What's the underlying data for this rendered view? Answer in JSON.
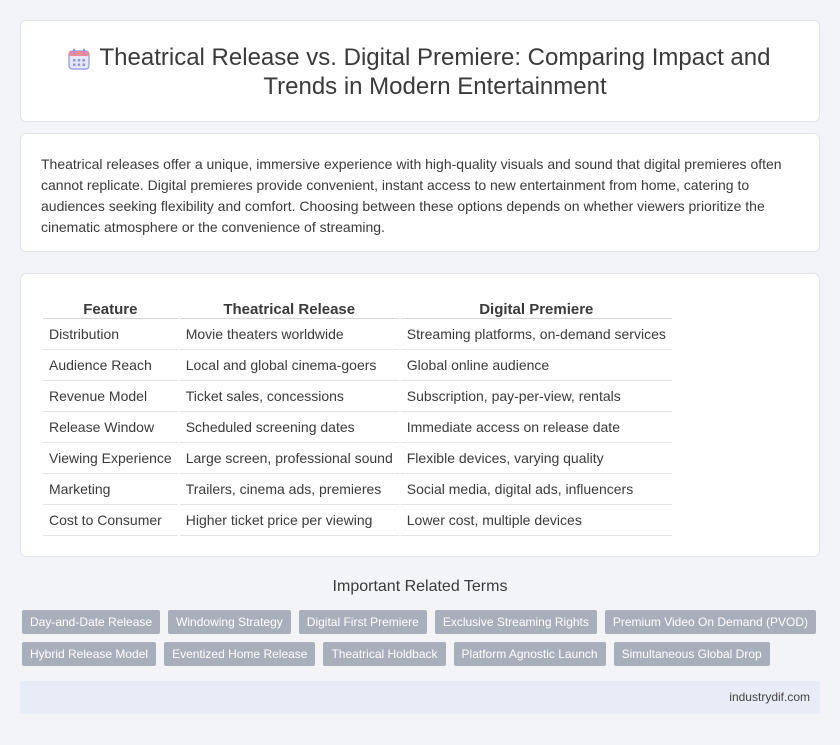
{
  "header": {
    "title": "Theatrical Release vs. Digital Premiere: Comparing Impact and Trends in Modern Entertainment",
    "icon": "calendar-icon",
    "icon_color": "#7b82d6"
  },
  "intro": {
    "text": "Theatrical releases offer a unique, immersive experience with high-quality visuals and sound that digital premieres often cannot replicate. Digital premieres provide convenient, instant access to new entertainment from home, catering to audiences seeking flexibility and comfort. Choosing between these options depends on whether viewers prioritize the cinematic atmosphere or the convenience of streaming."
  },
  "comparison": {
    "headers": [
      "Feature",
      "Theatrical Release",
      "Digital Premiere"
    ],
    "rows": [
      [
        "Distribution",
        "Movie theaters worldwide",
        "Streaming platforms, on-demand services"
      ],
      [
        "Audience Reach",
        "Local and global cinema-goers",
        "Global online audience"
      ],
      [
        "Revenue Model",
        "Ticket sales, concessions",
        "Subscription, pay-per-view, rentals"
      ],
      [
        "Release Window",
        "Scheduled screening dates",
        "Immediate access on release date"
      ],
      [
        "Viewing Experience",
        "Large screen, professional sound",
        "Flexible devices, varying quality"
      ],
      [
        "Marketing",
        "Trailers, cinema ads, premieres",
        "Social media, digital ads, influencers"
      ],
      [
        "Cost to Consumer",
        "Higher ticket price per viewing",
        "Lower cost, multiple devices"
      ]
    ]
  },
  "related": {
    "heading": "Important Related Terms",
    "rows": [
      [
        "Day-and-Date Release",
        "Windowing Strategy",
        "Digital First Premiere",
        "Exclusive Streaming Rights",
        "Premium Video On Demand (PVOD)"
      ],
      [
        "Hybrid Release Model",
        "Eventized Home Release",
        "Theatrical Holdback",
        "Platform Agnostic Launch",
        "Simultaneous Global Drop"
      ]
    ],
    "tag_color": "#a9aebb"
  },
  "footer": {
    "text": "industrydif.com"
  }
}
